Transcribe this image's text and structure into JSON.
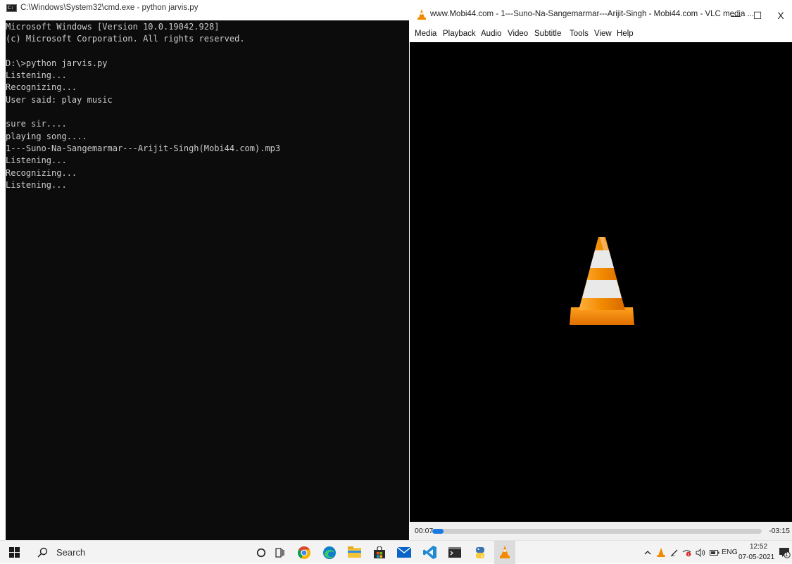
{
  "cmd": {
    "title": "C:\\Windows\\System32\\cmd.exe - python  jarvis.py",
    "lines": [
      "Microsoft Windows [Version 10.0.19042.928]",
      "(c) Microsoft Corporation. All rights reserved.",
      "",
      "D:\\>python jarvis.py",
      "Listening...",
      "Recognizing...",
      "User said: play music",
      "",
      "sure sir....",
      "playing song....",
      "1---Suno-Na-Sangemarmar---Arijit-Singh(Mobi44.com).mp3",
      "Listening...",
      "Recognizing...",
      "Listening..."
    ]
  },
  "vlc": {
    "title": "www.Mobi44.com - 1---Suno-Na-Sangemarmar---Arijit-Singh - Mobi44.com - VLC media ...",
    "minimize": "—",
    "maximize": "☐",
    "close": "X",
    "menu": [
      "Media",
      "Playback",
      "Audio",
      "Video",
      "Subtitle",
      "Tools",
      "View",
      "Help"
    ],
    "time_elapsed": "00:07",
    "time_remaining": "-03:15",
    "progress_fraction": 0.034,
    "accent_color": "#1a7ae0",
    "cone_color": "#f28a00"
  },
  "taskbar": {
    "search_label": "Search",
    "language": "ENG",
    "time": "12:52",
    "date": "07-05-2021",
    "notification_count": "1",
    "pinned_icons": [
      "cortana-icon",
      "task-view-icon",
      "chrome-icon",
      "edge-icon",
      "file-explorer-icon",
      "store-icon",
      "mail-icon",
      "vscode-icon",
      "terminal-icon",
      "python-icon",
      "vlc-icon"
    ],
    "tray_icons": [
      "chevron-up-icon",
      "vlc-tray-icon",
      "pen-icon",
      "network-icon",
      "volume-icon",
      "battery-icon"
    ]
  }
}
